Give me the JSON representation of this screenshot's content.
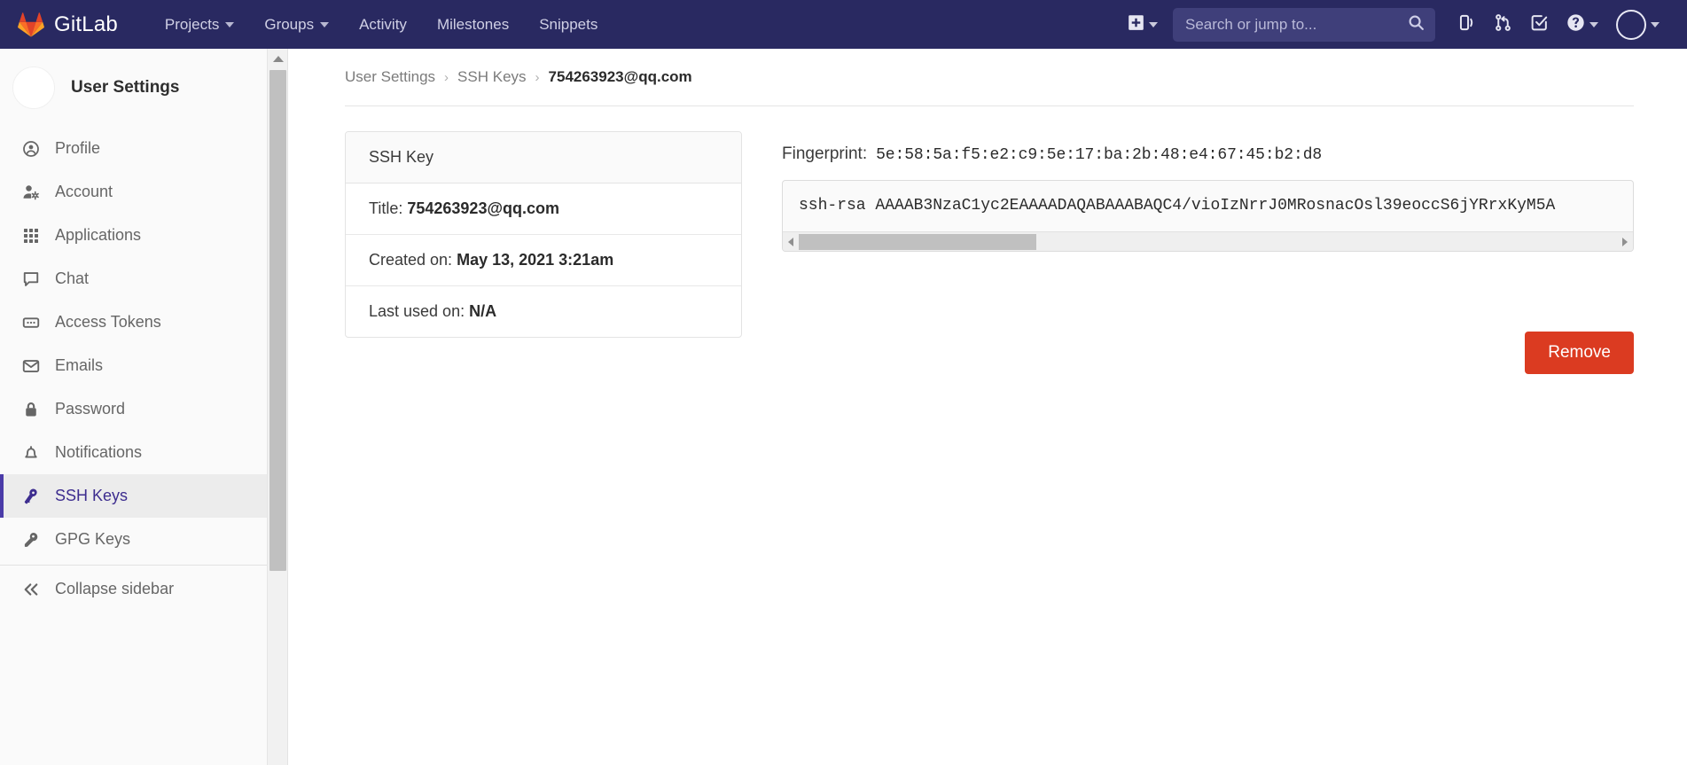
{
  "navbar": {
    "brand": "GitLab",
    "brand_logo_icon": "gitlab-tanuki-logo",
    "links": [
      {
        "label": "Projects",
        "has_caret": true
      },
      {
        "label": "Groups",
        "has_caret": true
      },
      {
        "label": "Activity",
        "has_caret": false
      },
      {
        "label": "Milestones",
        "has_caret": false
      },
      {
        "label": "Snippets",
        "has_caret": false
      }
    ],
    "create_new_icon": "plus-square-icon",
    "search": {
      "placeholder": "Search or jump to...",
      "value": "",
      "icon": "search-icon"
    },
    "icons": [
      {
        "name": "issues-icon"
      },
      {
        "name": "merge-requests-icon"
      },
      {
        "name": "todos-checkbox-icon"
      },
      {
        "name": "help-question-icon"
      }
    ],
    "avatar_icon": "user-avatar-circle",
    "background_color": "#292961"
  },
  "sidebar": {
    "title": "User Settings",
    "avatar_icon": "user-avatar-circle",
    "items": [
      {
        "label": "Profile",
        "icon": "profile-user-circle-icon",
        "active": false
      },
      {
        "label": "Account",
        "icon": "account-user-gear-icon",
        "active": false
      },
      {
        "label": "Applications",
        "icon": "applications-grid-icon",
        "active": false
      },
      {
        "label": "Chat",
        "icon": "chat-bubble-icon",
        "active": false
      },
      {
        "label": "Access Tokens",
        "icon": "access-tokens-icon",
        "active": false
      },
      {
        "label": "Emails",
        "icon": "email-envelope-icon",
        "active": false
      },
      {
        "label": "Password",
        "icon": "password-lock-icon",
        "active": false
      },
      {
        "label": "Notifications",
        "icon": "notifications-bell-icon",
        "active": false
      },
      {
        "label": "SSH Keys",
        "icon": "ssh-key-icon",
        "active": true
      },
      {
        "label": "GPG Keys",
        "icon": "gpg-key-icon",
        "active": false
      }
    ],
    "collapse": {
      "label": "Collapse sidebar",
      "icon": "double-chevron-left-icon"
    },
    "active_color": "#3d2d8f"
  },
  "breadcrumb": {
    "items": [
      "User Settings",
      "SSH Keys"
    ],
    "current": "754263923@qq.com",
    "separator": "›"
  },
  "key_card": {
    "heading": "SSH Key",
    "rows": [
      {
        "label": "Title:",
        "value": "754263923@qq.com"
      },
      {
        "label": "Created on:",
        "value": "May 13, 2021 3:21am"
      },
      {
        "label": "Last used on:",
        "value": "N/A"
      }
    ]
  },
  "key_detail": {
    "fingerprint_label": "Fingerprint:",
    "fingerprint_value": "5e:58:5a:f5:e2:c9:5e:17:ba:2b:48:e4:67:45:b2:d8",
    "key_text": "ssh-rsa AAAAB3NzaC1yc2EAAAADAQABAAABAQC4/vioIzNrrJ0MRosnacOsl39eoccS6jYRrxKyM5A",
    "scrollbar": {
      "left_arrow_icon": "arrow-left-icon",
      "right_arrow_icon": "arrow-right-icon"
    }
  },
  "actions": {
    "remove_label": "Remove",
    "remove_color": "#db3b21"
  }
}
